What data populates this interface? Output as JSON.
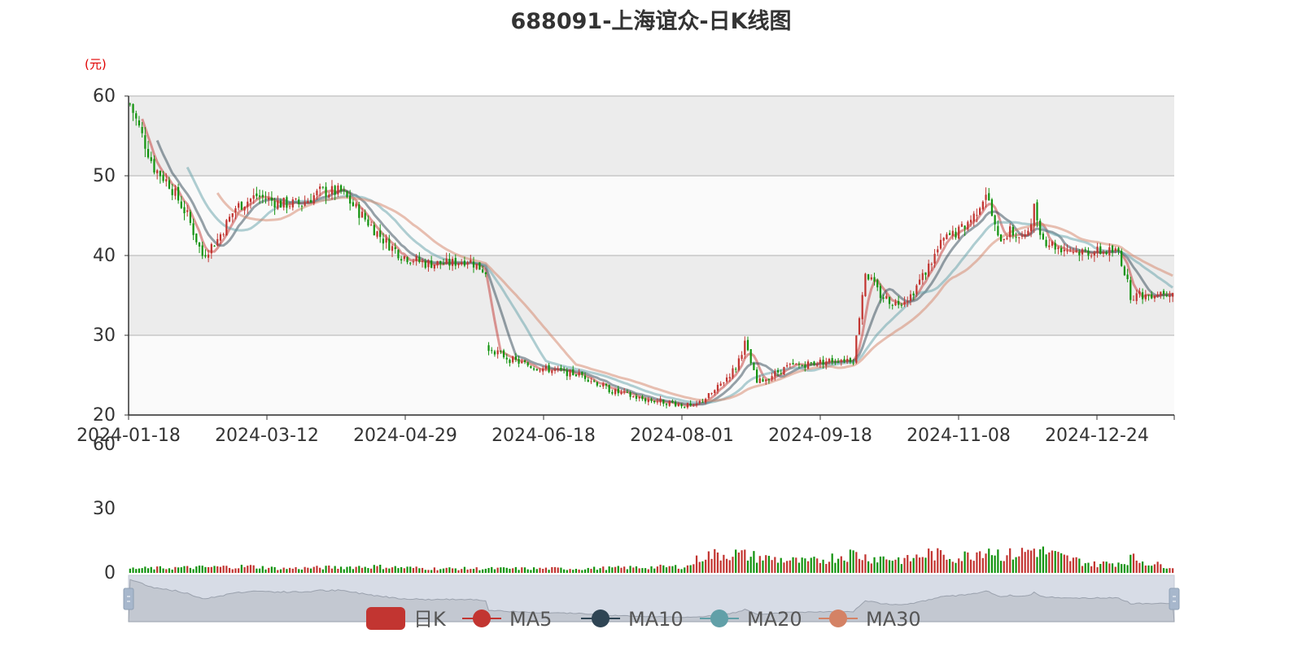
{
  "title": "688091-上海谊众-日K线图",
  "price_unit": "(元)",
  "colors": {
    "up": "#c23531",
    "down": "#13930f",
    "ma5": "#c23531",
    "ma10": "#2f4554",
    "ma20": "#61a0a8",
    "ma30": "#d48265",
    "band": "#ececec",
    "band_alt": "#fafafa"
  },
  "legend": {
    "items": [
      {
        "label": "日K",
        "color": "#c23531",
        "icon": "candle-icon"
      },
      {
        "label": "MA5",
        "color": "#c23531",
        "icon": "line-dot-icon"
      },
      {
        "label": "MA10",
        "color": "#2f4554",
        "icon": "line-dot-icon"
      },
      {
        "label": "MA20",
        "color": "#61a0a8",
        "icon": "line-dot-icon"
      },
      {
        "label": "MA30",
        "color": "#d48265",
        "icon": "line-dot-icon"
      }
    ]
  },
  "chart_data": {
    "type": "candlestick",
    "x_tick_labels": [
      "2024-01-18",
      "2024-03-12",
      "2024-04-29",
      "2024-06-18",
      "2024-08-01",
      "2024-09-18",
      "2024-11-08",
      "2024-12-24"
    ],
    "y_ticks": [
      20,
      30,
      40,
      50,
      60
    ],
    "ylim": [
      20,
      60
    ],
    "volume_ticks": [
      0,
      30,
      60
    ],
    "volume_ylim": [
      0,
      60
    ],
    "price_path": [
      [
        0,
        59
      ],
      [
        4,
        55
      ],
      [
        8,
        51
      ],
      [
        13,
        49
      ],
      [
        19,
        45
      ],
      [
        24,
        40
      ],
      [
        29,
        42
      ],
      [
        35,
        46
      ],
      [
        42,
        47.5
      ],
      [
        50,
        46.5
      ],
      [
        57,
        46.5
      ],
      [
        63,
        48
      ],
      [
        70,
        48
      ],
      [
        77,
        45
      ],
      [
        84,
        42
      ],
      [
        90,
        40
      ],
      [
        98,
        39
      ],
      [
        106,
        39
      ],
      [
        112,
        39.5
      ],
      [
        118,
        38
      ],
      [
        119,
        28.5
      ],
      [
        126,
        27
      ],
      [
        134,
        26
      ],
      [
        142,
        25.5
      ],
      [
        150,
        25
      ],
      [
        160,
        23
      ],
      [
        170,
        22
      ],
      [
        180,
        21.5
      ],
      [
        187,
        21
      ],
      [
        194,
        23
      ],
      [
        201,
        26
      ],
      [
        204,
        29
      ],
      [
        208,
        24
      ],
      [
        213,
        25
      ],
      [
        218,
        26
      ],
      [
        226,
        26.5
      ],
      [
        236,
        27
      ],
      [
        240,
        27
      ],
      [
        244,
        38
      ],
      [
        249,
        35
      ],
      [
        254,
        34
      ],
      [
        259,
        35
      ],
      [
        264,
        38
      ],
      [
        270,
        42
      ],
      [
        275,
        43
      ],
      [
        280,
        45
      ],
      [
        284,
        48
      ],
      [
        288,
        42
      ],
      [
        292,
        43
      ],
      [
        297,
        42
      ],
      [
        300,
        46
      ],
      [
        303,
        42
      ],
      [
        308,
        41
      ],
      [
        315,
        40.5
      ],
      [
        322,
        40.5
      ],
      [
        328,
        40.5
      ],
      [
        330,
        38
      ],
      [
        332,
        35
      ],
      [
        337,
        35
      ],
      [
        342,
        35.5
      ],
      [
        346,
        35.5
      ]
    ],
    "volume_profile": [
      [
        0,
        2
      ],
      [
        40,
        3
      ],
      [
        50,
        2
      ],
      [
        80,
        3
      ],
      [
        100,
        2
      ],
      [
        150,
        2
      ],
      [
        185,
        3
      ],
      [
        190,
        8
      ],
      [
        200,
        9
      ],
      [
        210,
        7
      ],
      [
        225,
        5
      ],
      [
        240,
        9
      ],
      [
        245,
        7
      ],
      [
        250,
        7
      ],
      [
        258,
        6
      ],
      [
        265,
        9
      ],
      [
        275,
        7
      ],
      [
        280,
        9
      ],
      [
        284,
        12
      ],
      [
        290,
        8
      ],
      [
        295,
        9
      ],
      [
        300,
        11
      ],
      [
        310,
        7
      ],
      [
        320,
        4
      ],
      [
        330,
        5
      ],
      [
        332,
        7
      ],
      [
        340,
        4
      ],
      [
        346,
        3
      ]
    ],
    "ma_windows": [
      5,
      10,
      20,
      30
    ],
    "total_days": 347
  }
}
